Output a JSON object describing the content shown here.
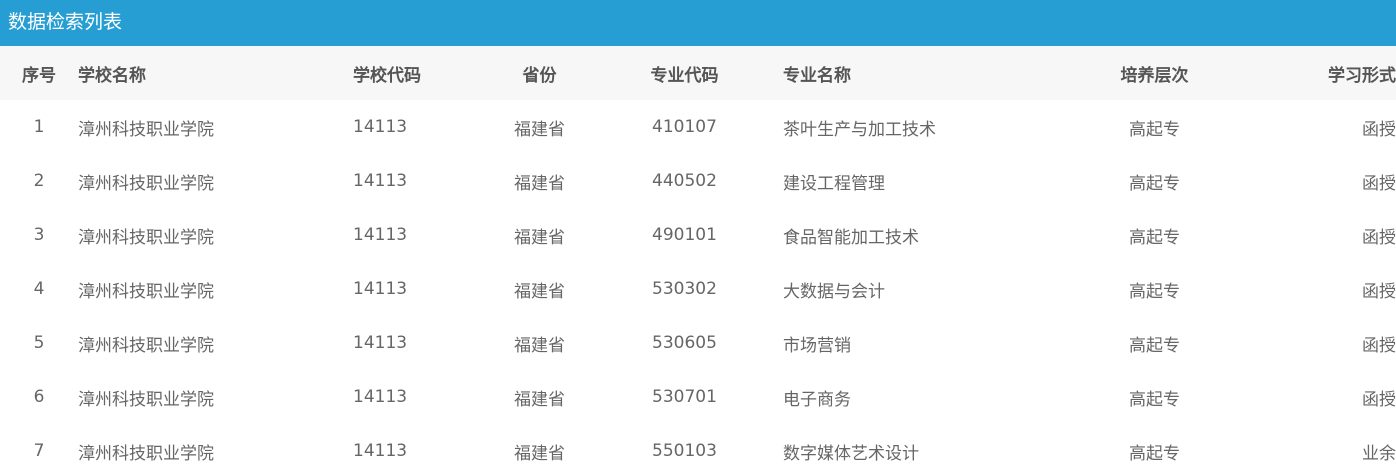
{
  "panel": {
    "title": "数据检索列表",
    "header_bg": "#279ed3"
  },
  "table": {
    "columns": [
      "序号",
      "学校名称",
      "学校代码",
      "省份",
      "专业代码",
      "专业名称",
      "培养层次",
      "学习形式"
    ],
    "rows": [
      [
        "1",
        "漳州科技职业学院",
        "14113",
        "福建省",
        "410107",
        "茶叶生产与加工技术",
        "高起专",
        "函授"
      ],
      [
        "2",
        "漳州科技职业学院",
        "14113",
        "福建省",
        "440502",
        "建设工程管理",
        "高起专",
        "函授"
      ],
      [
        "3",
        "漳州科技职业学院",
        "14113",
        "福建省",
        "490101",
        "食品智能加工技术",
        "高起专",
        "函授"
      ],
      [
        "4",
        "漳州科技职业学院",
        "14113",
        "福建省",
        "530302",
        "大数据与会计",
        "高起专",
        "函授"
      ],
      [
        "5",
        "漳州科技职业学院",
        "14113",
        "福建省",
        "530605",
        "市场营销",
        "高起专",
        "函授"
      ],
      [
        "6",
        "漳州科技职业学院",
        "14113",
        "福建省",
        "530701",
        "电子商务",
        "高起专",
        "函授"
      ],
      [
        "7",
        "漳州科技职业学院",
        "14113",
        "福建省",
        "550103",
        "数字媒体艺术设计",
        "高起专",
        "业余"
      ]
    ]
  }
}
